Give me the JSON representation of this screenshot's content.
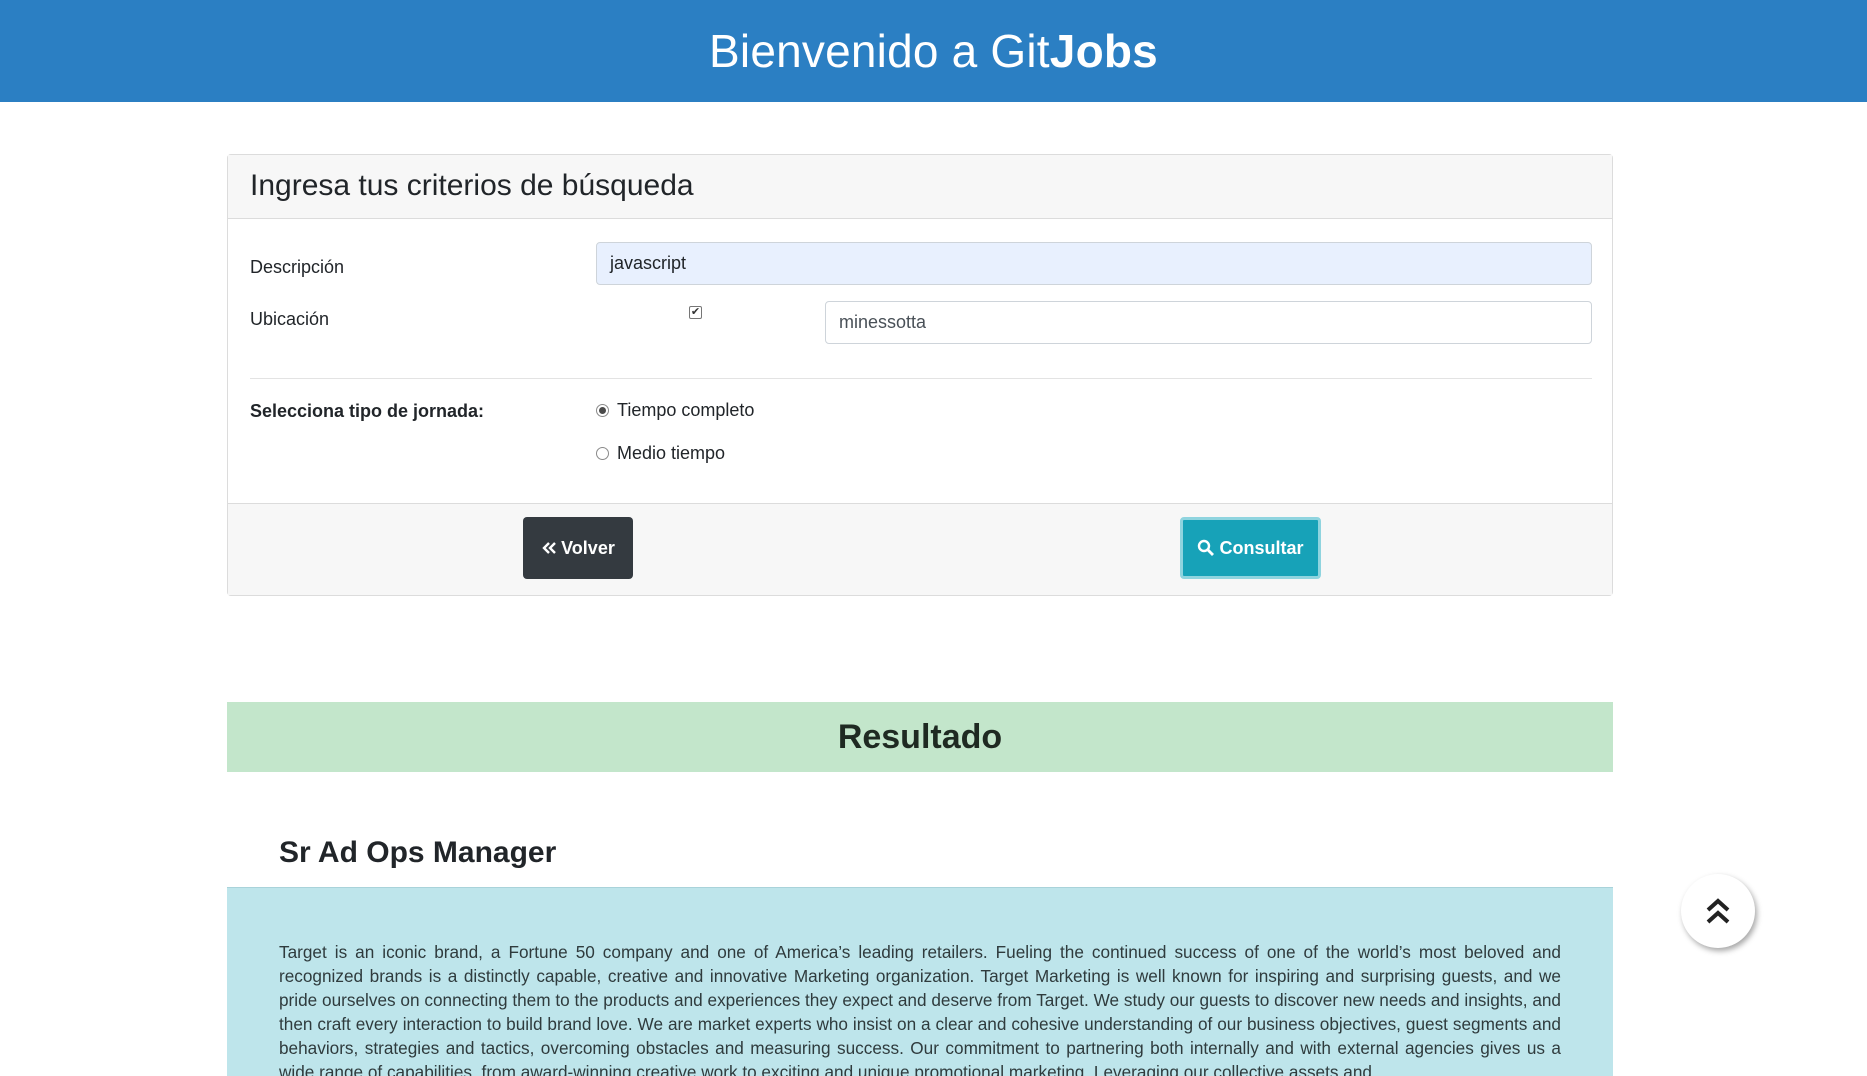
{
  "header": {
    "title_prefix": "Bienvenido a Git",
    "title_bold": "Jobs"
  },
  "search": {
    "title": "Ingresa tus criterios de búsqueda",
    "description_label": "Descripción",
    "description_value": "javascript",
    "location_label": "Ubicación",
    "location_checked": true,
    "location_value": "minessotta",
    "jornada_label": "Selecciona tipo de jornada:",
    "options": [
      {
        "label": "Tiempo completo",
        "selected": true
      },
      {
        "label": "Medio tiempo",
        "selected": false
      }
    ],
    "back_button": "Volver",
    "submit_button": "Consultar"
  },
  "results": {
    "heading": "Resultado",
    "job_title": "Sr Ad Ops Manager",
    "job_description": "Target is an iconic brand, a Fortune 50 company and one of America’s leading retailers. Fueling the continued success of one of the world’s most beloved and recognized brands is a distinctly capable, creative and innovative Marketing organization. Target Marketing is well known for inspiring and surprising guests, and we pride ourselves on connecting them to the products and experiences they expect and deserve from Target. We study our guests to discover new needs and insights, and then craft every interaction to build brand love. We are market experts who insist on a clear and cohesive understanding of our business objectives, guest segments and behaviors, strategies and tactics, overcoming obstacles and measuring success. Our commitment to partnering both internally and with external agencies gives us a wide range of capabilities, from award-winning creative work to exciting and unique promotional marketing. Leveraging our collective assets and"
  },
  "icons": {
    "back": "double-chevron-left-icon",
    "search": "search-icon",
    "scroll_top": "double-chevron-up-icon"
  },
  "colors": {
    "header": "#2b7fc3",
    "result_banner": "#c3e6cb",
    "job_body": "#bee5eb",
    "btn_dark": "#343a40",
    "btn_info": "#17a2b8"
  }
}
